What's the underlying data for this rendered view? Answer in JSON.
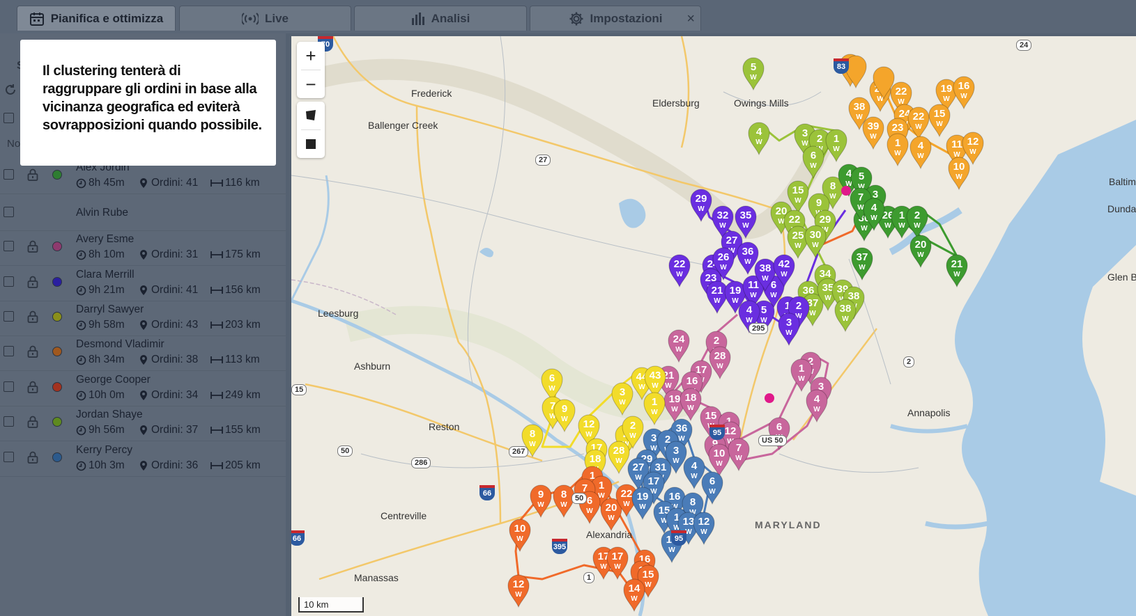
{
  "tabs": [
    {
      "label": "Pianifica e ottimizza",
      "icon": "calendar-icon",
      "active": true
    },
    {
      "label": "Live",
      "icon": "broadcast-icon",
      "active": false
    },
    {
      "label": "Analisi",
      "icon": "bar-chart-icon",
      "active": false
    },
    {
      "label": "Impostazioni",
      "icon": "gear-icon",
      "active": false
    }
  ],
  "close_glyph": "×",
  "tooltip": {
    "text": "Il clustering tenterà di raggruppare gli ordini in base alla vicinanza geografica ed eviterà sovrapposizioni quando possibile."
  },
  "panel_stub": {
    "header_initial": "S",
    "col_initial": "No"
  },
  "drivers": [
    {
      "name": "Alex Jordin",
      "time": "8h 45m",
      "orders": "Ordini: 41",
      "distance": "116 km",
      "color": "#2e7d32",
      "locked": true
    },
    {
      "name": "Alvin Rube",
      "time": "",
      "orders": "",
      "distance": "",
      "color": "",
      "locked": false
    },
    {
      "name": "Avery Esme",
      "time": "8h 10m",
      "orders": "Ordini: 31",
      "distance": "175 km",
      "color": "#8e3a6e",
      "locked": true
    },
    {
      "name": "Clara Merrill",
      "time": "9h 21m",
      "orders": "Ordini: 41",
      "distance": "156 km",
      "color": "#2a1fa0",
      "locked": true
    },
    {
      "name": "Darryl Sawyer",
      "time": "9h 58m",
      "orders": "Ordini: 43",
      "distance": "203 km",
      "color": "#8a8f1a",
      "locked": true
    },
    {
      "name": "Desmond Vladimir",
      "time": "8h 34m",
      "orders": "Ordini: 38",
      "distance": "113 km",
      "color": "#a0581e",
      "locked": true
    },
    {
      "name": "George Cooper",
      "time": "10h 0m",
      "orders": "Ordini: 34",
      "distance": "249 km",
      "color": "#a3321f",
      "locked": true
    },
    {
      "name": "Jordan Shaye",
      "time": "9h 56m",
      "orders": "Ordini: 37",
      "distance": "155 km",
      "color": "#5e8a1f",
      "locked": true
    },
    {
      "name": "Kerry Percy",
      "time": "10h 3m",
      "orders": "Ordini: 36",
      "distance": "205 km",
      "color": "#2c5a8c",
      "locked": true
    }
  ],
  "map": {
    "zoom_in": "+",
    "zoom_out": "−",
    "scale_label": "10 km",
    "places": [
      "Frederick",
      "Ballenger Creek",
      "Eldersburg",
      "Owings Mills",
      "Leesburg",
      "Ashburn",
      "Reston",
      "Centreville",
      "Manassas",
      "Annapolis",
      "Glen Burnie",
      "MARYLAND",
      "Alexandria",
      "Baltimore",
      "Dundalk"
    ],
    "route_shields": [
      "70",
      "24",
      "83",
      "27",
      "295",
      "2",
      "15",
      "50",
      "286",
      "267",
      "66",
      "50",
      "395",
      "95",
      "1",
      "US 50",
      "66",
      "95"
    ],
    "marker_colors": {
      "orange": "#f4a52b",
      "lime": "#9bc33a",
      "green": "#3d9b2f",
      "purple": "#6a2ee0",
      "pink": "#c8669c",
      "yellow": "#f2dc2a",
      "red": "#f06a2a",
      "blue": "#4a7cb8"
    }
  }
}
